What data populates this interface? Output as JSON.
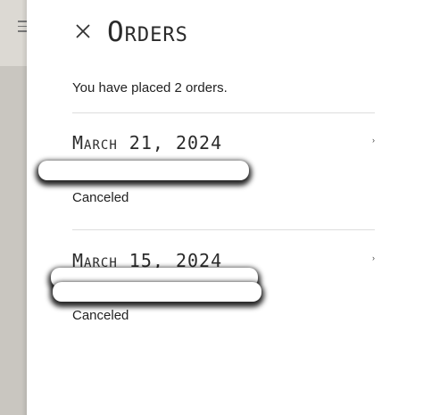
{
  "drawer": {
    "title": "Orders",
    "close_icon": "close-icon",
    "summary": "You have placed 2 orders."
  },
  "orders": [
    {
      "date": "March 21, 2024",
      "status": "Canceled",
      "chevron": "›"
    },
    {
      "date": "March 15, 2024",
      "status": "Canceled",
      "chevron": "›"
    }
  ]
}
